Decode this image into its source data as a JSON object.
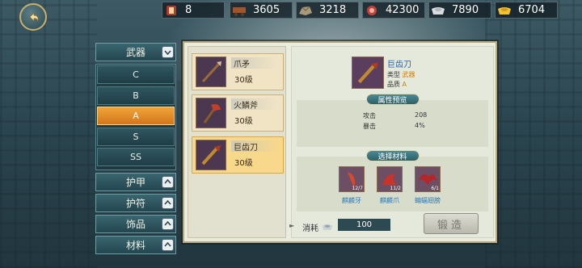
{
  "resources": [
    {
      "icon": "scroll-icon",
      "value": "8"
    },
    {
      "icon": "wood-cart-icon",
      "value": "3605"
    },
    {
      "icon": "ore-icon",
      "value": "3218"
    },
    {
      "icon": "meat-icon",
      "value": "42300"
    },
    {
      "icon": "silver-ingot-icon",
      "value": "7890"
    },
    {
      "icon": "gold-ingot-icon",
      "value": "6704"
    }
  ],
  "categories": {
    "weapon": {
      "label": "武器",
      "grades": [
        "C",
        "B",
        "A",
        "S",
        "SS"
      ],
      "selected_grade": "A"
    },
    "others": [
      "护甲",
      "护符",
      "饰品",
      "材料"
    ]
  },
  "items": [
    {
      "name": "爪矛",
      "level": "30级"
    },
    {
      "name": "火鳞斧",
      "level": "30级"
    },
    {
      "name": "巨齿刀",
      "level": "30级"
    }
  ],
  "detail": {
    "name": "巨齿刀",
    "type_label": "类型",
    "type_value": "武器",
    "quality_label": "品质",
    "quality_value": "A",
    "attr_title": "属性预览",
    "attrs": [
      {
        "name": "攻击",
        "value": "208"
      },
      {
        "name": "暴击",
        "value": "4%"
      }
    ],
    "mat_title": "选择材料",
    "materials": [
      {
        "name": "麒麟牙",
        "count": "12/7"
      },
      {
        "name": "麒麟爪",
        "count": "11/2"
      },
      {
        "name": "蝙蝠翅膀",
        "count": "6/1"
      }
    ]
  },
  "cost": {
    "arrow": "►",
    "label": "消耗",
    "value": "100"
  },
  "forge_label": "锻造",
  "colors": {
    "accent": "#f0a43a",
    "panel": "#e9ecde",
    "material_name": "#2a7ab8",
    "item_name": "#1f5fb0"
  }
}
